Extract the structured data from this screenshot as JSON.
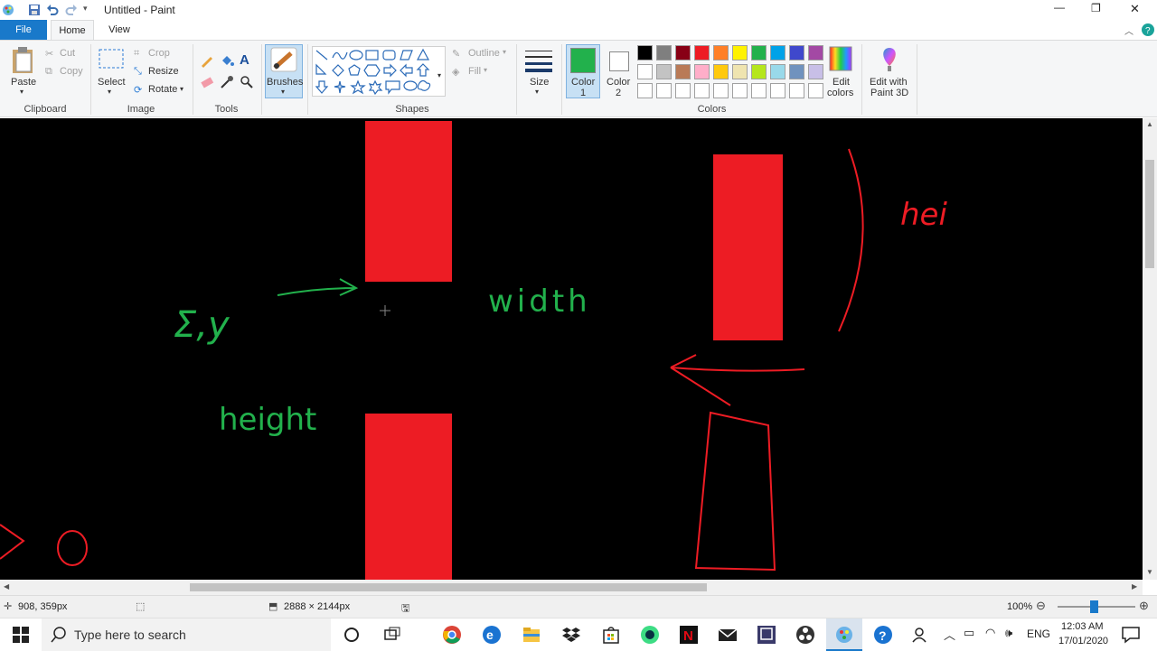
{
  "window": {
    "title": "Untitled - Paint",
    "controls": {
      "minimize": "—",
      "maximize": "❐",
      "close": "✕"
    }
  },
  "tabs": [
    {
      "label": "File"
    },
    {
      "label": "Home"
    },
    {
      "label": "View"
    }
  ],
  "ribbon": {
    "clipboard": {
      "paste": "Paste",
      "cut": "Cut",
      "copy": "Copy",
      "group": "Clipboard"
    },
    "image": {
      "select": "Select",
      "crop": "Crop",
      "resize": "Resize",
      "rotate": "Rotate",
      "group": "Image"
    },
    "tools": {
      "group": "Tools"
    },
    "brushes": {
      "label": "Brushes"
    },
    "shapes": {
      "outline": "Outline",
      "fill": "Fill",
      "group": "Shapes"
    },
    "size": {
      "label": "Size"
    },
    "colors": {
      "color1_label": "Color",
      "color1_num": "1",
      "color2_label": "Color",
      "color2_num": "2",
      "edit_colors_1": "Edit",
      "edit_colors_2": "colors",
      "edit3d_1": "Edit with",
      "edit3d_2": "Paint 3D",
      "group": "Colors",
      "color1": "#22b14c",
      "color2": "#ffffff",
      "palette_row1": [
        "#000000",
        "#7f7f7f",
        "#880015",
        "#ed1c24",
        "#ff7f27",
        "#fff200",
        "#22b14c",
        "#00a2e8",
        "#3f48cc",
        "#a349a4"
      ],
      "palette_row2": [
        "#ffffff",
        "#c3c3c3",
        "#b97a57",
        "#ffaec9",
        "#ffc90e",
        "#efe4b0",
        "#b5e61d",
        "#99d9ea",
        "#7092be",
        "#c8bfe7"
      ],
      "palette_row3": [
        "#ffffff",
        "#ffffff",
        "#ffffff",
        "#ffffff",
        "#ffffff",
        "#ffffff",
        "#ffffff",
        "#ffffff",
        "#ffffff",
        "#ffffff"
      ]
    }
  },
  "canvas": {
    "labels": {
      "xy": "Σ,y",
      "width": "width",
      "height": "height",
      "hei": "hei"
    },
    "colors": {
      "red": "#ed1c24",
      "green": "#22b14c"
    }
  },
  "status": {
    "cursor_pos": "908, 359px",
    "image_size": "2888 × 2144px",
    "zoom": "100%"
  },
  "taskbar": {
    "search_placeholder": "Type here to search",
    "lang": "ENG",
    "time": "12:03 AM",
    "date": "17/01/2020"
  }
}
